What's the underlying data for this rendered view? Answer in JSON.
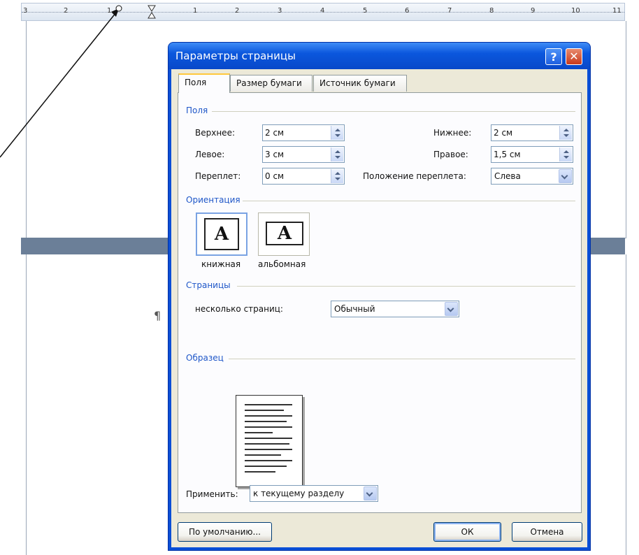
{
  "ruler": {
    "numbers": [
      "3",
      "2",
      "1",
      "1",
      "2",
      "3",
      "4",
      "5",
      "6",
      "7",
      "8",
      "9",
      "10",
      "11"
    ]
  },
  "document": {
    "pilcrow": "¶"
  },
  "dialog": {
    "title": "Параметры страницы",
    "help_glyph": "?",
    "close_glyph": "✕",
    "tabs": [
      "Поля",
      "Размер бумаги",
      "Источник бумаги"
    ],
    "margins": {
      "group_label": "Поля",
      "top_label": "Верхнее:",
      "top_value": "2 см",
      "bottom_label": "Нижнее:",
      "bottom_value": "2 см",
      "left_label": "Левое:",
      "left_value": "3 см",
      "right_label": "Правое:",
      "right_value": "1,5 см",
      "gutter_label": "Переплет:",
      "gutter_value": "0 см",
      "gutter_pos_label": "Положение переплета:",
      "gutter_pos_value": "Слева"
    },
    "orientation": {
      "group_label": "Ориентация",
      "portrait_label": "книжная",
      "landscape_label": "альбомная",
      "icon_letter": "A"
    },
    "pages": {
      "group_label": "Страницы",
      "multiple_label": "несколько страниц:",
      "multiple_value": "Обычный"
    },
    "sample": {
      "group_label": "Образец",
      "apply_label": "Применить:",
      "apply_value": "к текущему разделу"
    },
    "buttons": {
      "default": "По умолчанию...",
      "ok": "ОК",
      "cancel": "Отмена"
    }
  }
}
